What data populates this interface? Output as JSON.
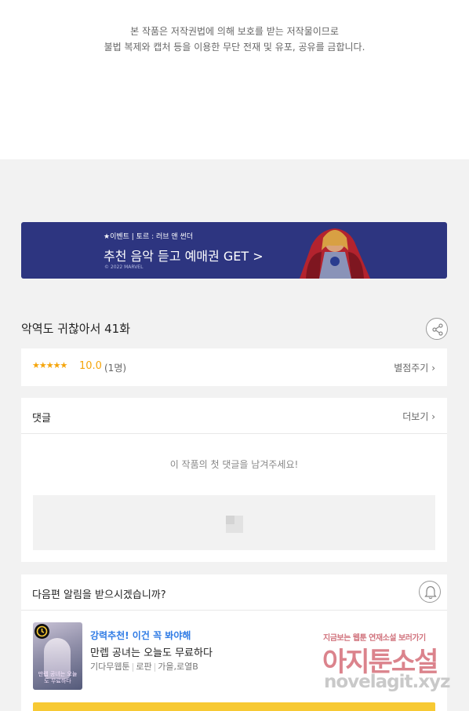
{
  "copyright": {
    "line1": "본 작품은 저작권법에 의해 보호를 받는 저작물이므로",
    "line2": "불법 복제와 캡처 등을 이용한 무단 전재 및 유포, 공유를 금합니다."
  },
  "banner": {
    "small": "★이벤트 | 토르 : 러브 앤 썬더",
    "main": "추천 음악 듣고 예매권 GET >",
    "copyright": "© 2022 MARVEL"
  },
  "episode": {
    "title": "악역도 귀찮아서 41화"
  },
  "rating": {
    "stars": "★★★★★",
    "score": "10.0",
    "count": "(1명)",
    "rate_link": "별점주기",
    "colors": {
      "accent": "#f5a50b"
    }
  },
  "comments": {
    "title": "댓글",
    "more": "더보기",
    "empty_message": "이 작품의 첫 댓글을 남겨주세요!"
  },
  "notify": {
    "title": "다음편 알림을 받으시겠습니까?",
    "recommend": {
      "tag": "강력추천! 이건 꼭 봐야해",
      "title": "만렙 공녀는 오늘도 무료하다",
      "meta": [
        "기다무웹툰",
        "로판",
        "가을,로열B"
      ],
      "thumb_text": "만렙 공녀는 오늘도 무료하다"
    },
    "colors": {
      "tag": "#2f7be5",
      "cta": "#f7c933"
    }
  },
  "watermark": {
    "line1": "지금보는 웹툰 연재소설 보러가기",
    "line2": "아지툰소설",
    "line3": "novelagit.xyz"
  },
  "icons": {
    "share": "share-icon",
    "bell": "bell-icon",
    "image": "image-icon",
    "clock": "clock-icon",
    "chevron": "chevron-right-icon"
  }
}
